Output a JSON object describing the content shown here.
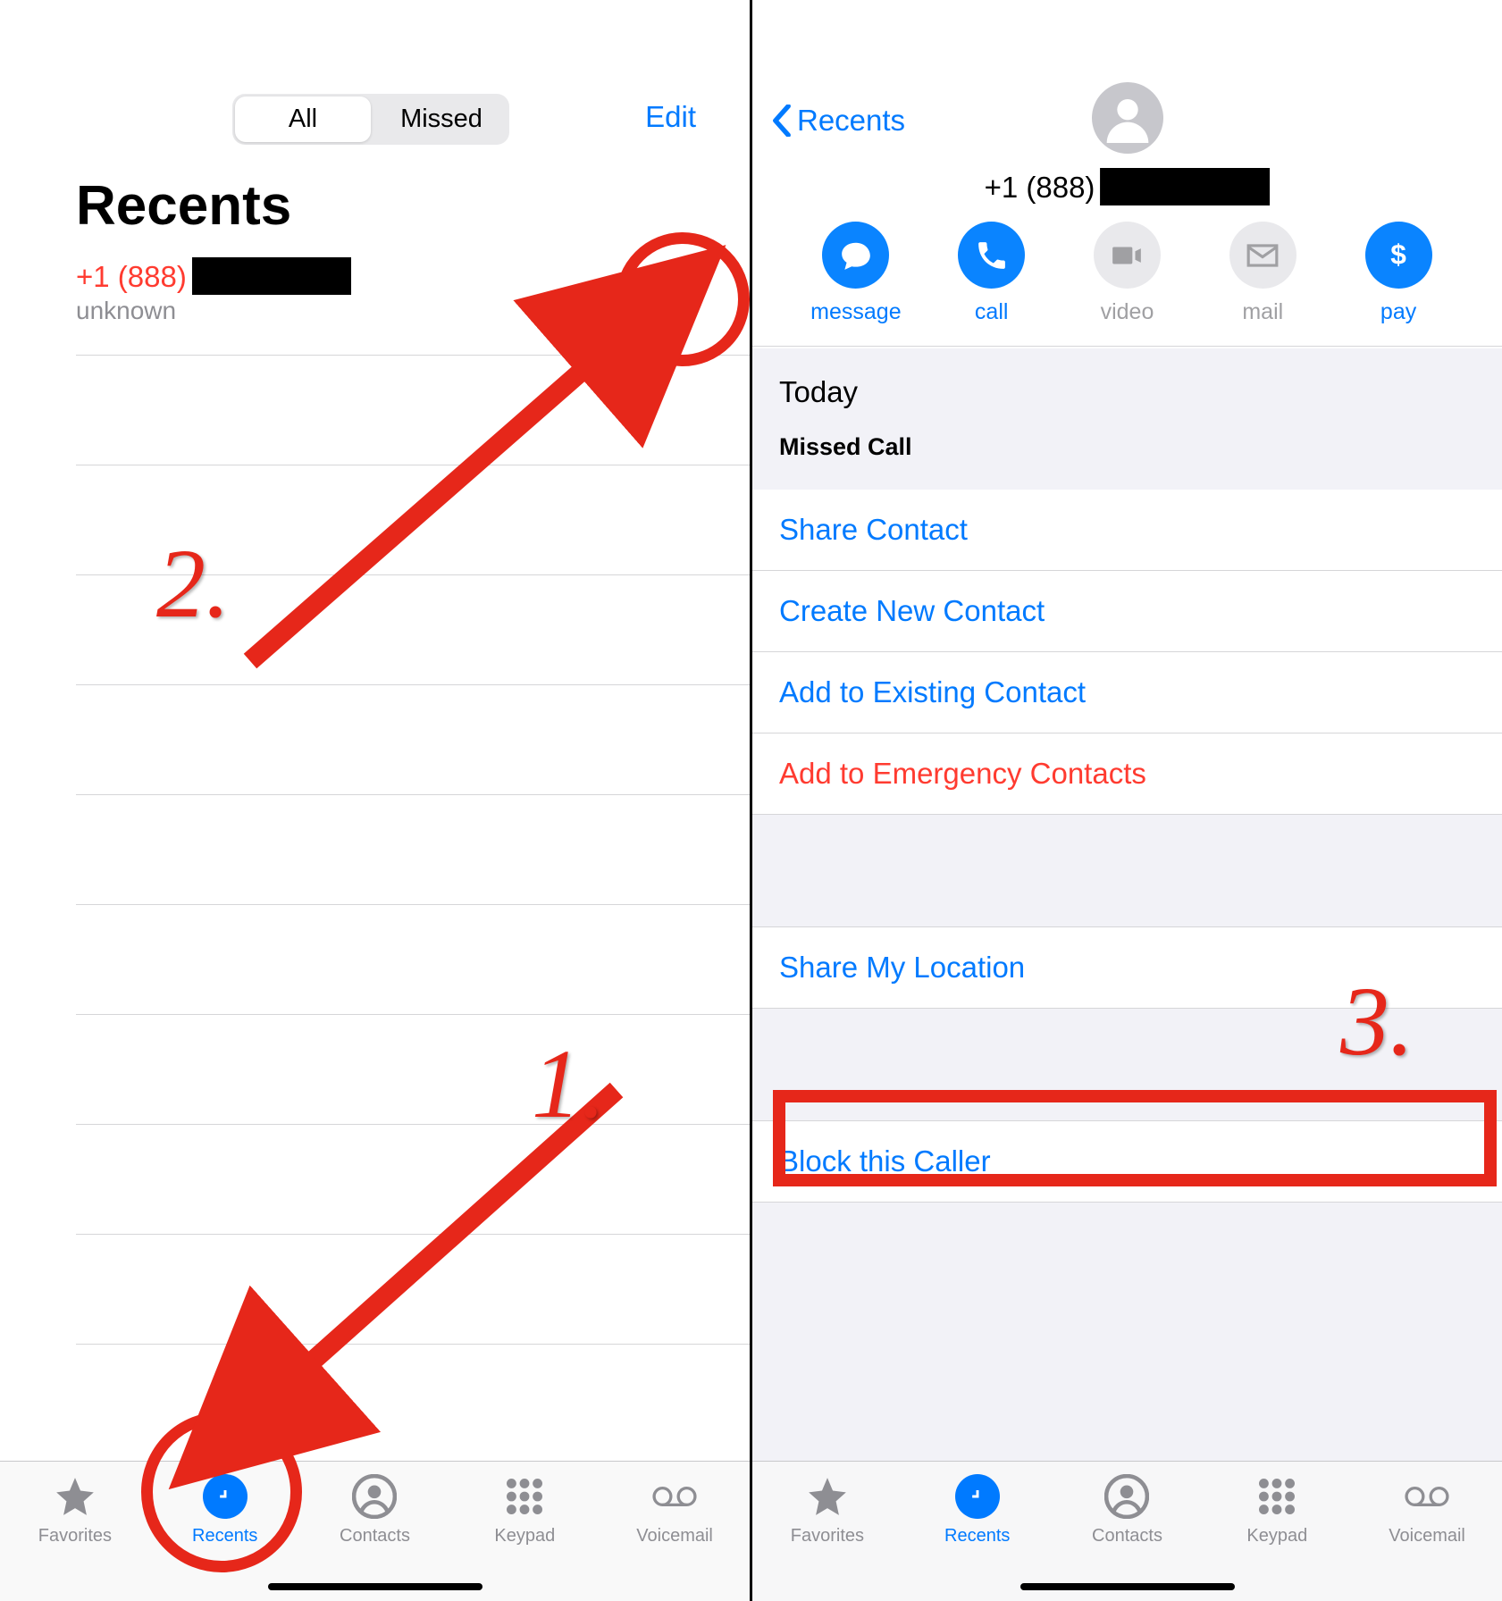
{
  "left": {
    "segments": {
      "all": "All",
      "missed": "Missed"
    },
    "edit": "Edit",
    "title": "Recents",
    "call": {
      "prefix": "+1 (888)",
      "subtitle": "unknown"
    },
    "tabs": {
      "favorites": "Favorites",
      "recents": "Recents",
      "contacts": "Contacts",
      "keypad": "Keypad",
      "voicemail": "Voicemail"
    }
  },
  "right": {
    "back": "Recents",
    "phone_prefix": "+1 (888)",
    "actions": {
      "message": "message",
      "call": "call",
      "video": "video",
      "mail": "mail",
      "pay": "pay"
    },
    "today": "Today",
    "missed_label": "Missed Call",
    "items": {
      "share_contact": "Share Contact",
      "create_contact": "Create New Contact",
      "add_existing": "Add to Existing Contact",
      "add_emergency": "Add to Emergency Contacts",
      "share_location": "Share My Location",
      "block": "Block this Caller"
    },
    "tabs": {
      "favorites": "Favorites",
      "recents": "Recents",
      "contacts": "Contacts",
      "keypad": "Keypad",
      "voicemail": "Voicemail"
    }
  },
  "annotations": {
    "step1": "1.",
    "step2": "2.",
    "step3": "3."
  }
}
